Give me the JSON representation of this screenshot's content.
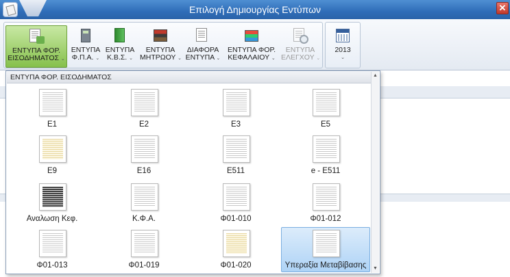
{
  "window": {
    "title": "Επιλογή Δημιουργίας Εντύπων",
    "close_label": "✕"
  },
  "ribbon": {
    "buttons": [
      {
        "line1": "ΕΝΤΥΠΑ ΦΟΡ.",
        "line2": "ΕΙΣΟΔΗΜΑΤΟΣ",
        "icon": "tax-form-icon",
        "state": "active"
      },
      {
        "line1": "ΕΝΤΥΠΑ",
        "line2": "Φ.Π.Α.",
        "icon": "calculator-icon",
        "state": "normal"
      },
      {
        "line1": "ΕΝΤΥΠΑ",
        "line2": "Κ.Β.Σ.",
        "icon": "book-icon",
        "state": "normal"
      },
      {
        "line1": "ΕΝΤΥΠΑ",
        "line2": "ΜΗΤΡΩΟΥ",
        "icon": "registry-books-icon",
        "state": "normal"
      },
      {
        "line1": "ΔΙΑΦΟΡΑ",
        "line2": "ΕΝΤΥΠΑ",
        "icon": "misc-forms-icon",
        "state": "normal"
      },
      {
        "line1": "ΕΝΤΥΠΑ ΦΟΡ.",
        "line2": "ΚΕΦΑΛΑΙΟΥ",
        "icon": "capital-books-icon",
        "state": "normal"
      },
      {
        "line1": "ΕΝΤΥΠΑ",
        "line2": "ΕΛΕΓΧΟΥ",
        "icon": "audit-magnifier-icon",
        "state": "disabled"
      }
    ],
    "year_button": {
      "label": "2013",
      "icon": "calendar-icon"
    },
    "caret": "⌄"
  },
  "gallery": {
    "header": "ΕΝΤΥΠΑ ΦΟΡ. ΕΙΣΟΔΗΜΑΤΟΣ",
    "items": [
      {
        "label": "E1"
      },
      {
        "label": "E2"
      },
      {
        "label": "E3"
      },
      {
        "label": "E5"
      },
      {
        "label": "E9"
      },
      {
        "label": "E16"
      },
      {
        "label": "E511"
      },
      {
        "label": "e - E511"
      },
      {
        "label": "Αναλωση Κεφ."
      },
      {
        "label": "Κ.Φ.Α."
      },
      {
        "label": "Φ01-010"
      },
      {
        "label": "Φ01-012"
      },
      {
        "label": "Φ01-013"
      },
      {
        "label": "Φ01-019"
      },
      {
        "label": "Φ01-020"
      },
      {
        "label": "Υπεραξία Μεταβίβασης"
      }
    ],
    "selected_item": "Υπεραξία Μεταβίβασης",
    "scroll_up": "▲",
    "scroll_down": "▼"
  }
}
